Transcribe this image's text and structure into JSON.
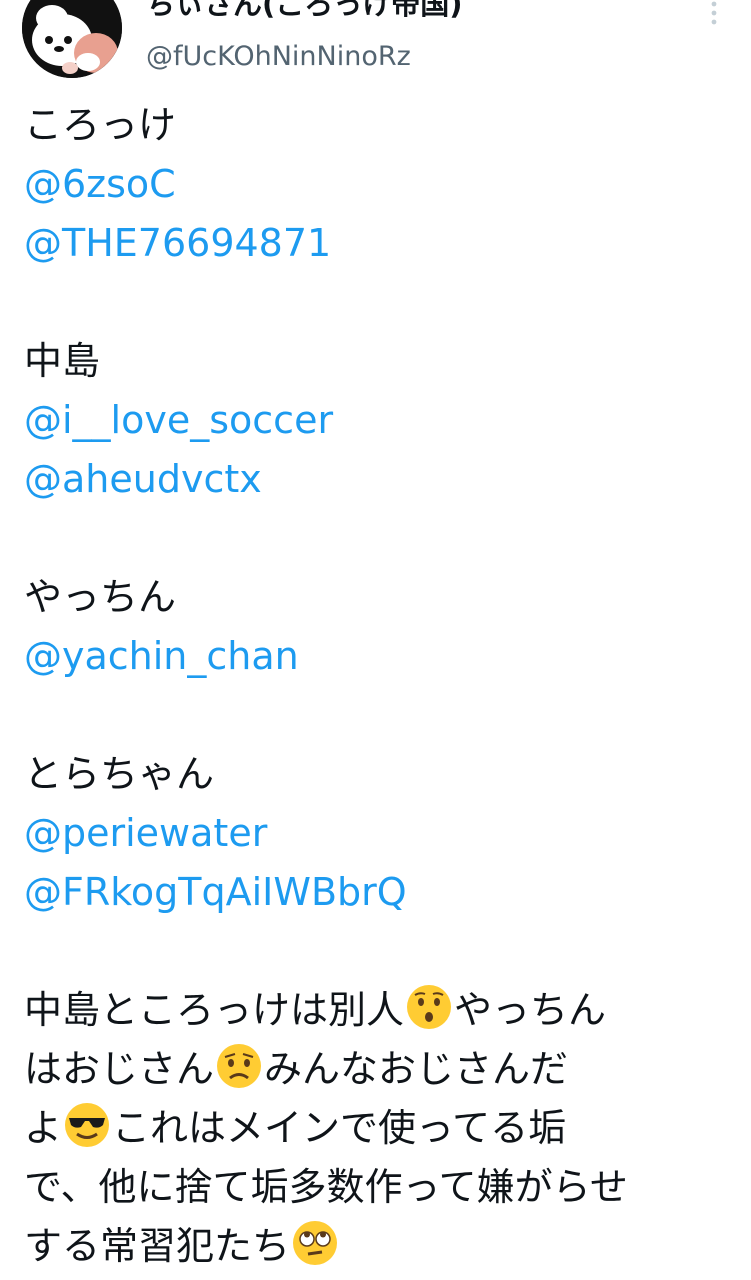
{
  "author": {
    "display_name": "ちぃさん(ころっけ帝国)",
    "handle": "@fUcKOhNinNinoRz"
  },
  "icons": {
    "more": "more-vertical-icon",
    "surprised": "hushed-face-emoji",
    "worried": "worried-face-emoji",
    "cool": "sunglasses-face-emoji",
    "eyeroll": "rolling-eyes-emoji"
  },
  "colors": {
    "mention": "#1d9bf0",
    "text": "#0f1419",
    "handle": "#536471"
  },
  "tweet": {
    "groups": [
      {
        "name": "ころっけ",
        "mentions": [
          "@6zsoC",
          "@THE76694871"
        ]
      },
      {
        "name": "中島",
        "mentions": [
          "@i__love_soccer",
          "@aheudvctx"
        ]
      },
      {
        "name": "やっちん",
        "mentions": [
          "@yachin_chan"
        ]
      },
      {
        "name": "とらちゃん",
        "mentions": [
          "@periewater",
          "@FRkogTqAiIWBbrQ"
        ]
      }
    ],
    "closing": {
      "seg1": "中島ところっけは別人",
      "seg2": "やっちん",
      "seg3": "はおじさん",
      "seg4": "みんなおじさんだ",
      "seg5": "よ",
      "seg6": "これはメインで使ってる垢",
      "seg7": "で、他に捨て垢多数作って嫌がらせ",
      "seg8": "する常習犯たち"
    }
  }
}
